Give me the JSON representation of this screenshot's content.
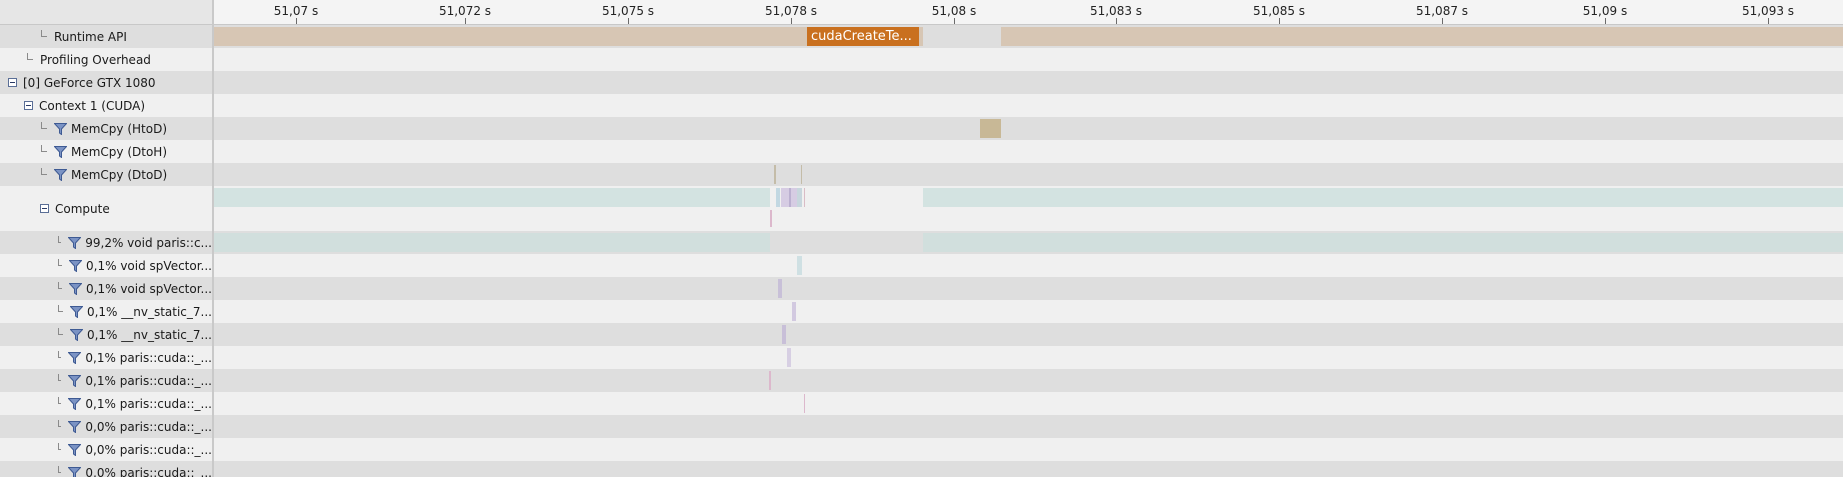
{
  "ruler": {
    "ticks": [
      "51,07 s",
      "51,072 s",
      "51,075 s",
      "51,078 s",
      "51,08 s",
      "51,083 s",
      "51,085 s",
      "51,087 s",
      "51,09 s",
      "51,093 s"
    ]
  },
  "tree": {
    "runtime_api": "Runtime API",
    "profiling_overhead": "Profiling Overhead",
    "gpu": "[0] GeForce GTX 1080",
    "context": "Context 1 (CUDA)",
    "memcpy_htod": "MemCpy (HtoD)",
    "memcpy_dtoh": "MemCpy (DtoH)",
    "memcpy_dtod": "MemCpy (DtoD)",
    "compute": "Compute",
    "kernels": [
      "99,2% void paris::c...",
      "0,1% void spVector...",
      "0,1% void spVector...",
      "0,1% __nv_static_7...",
      "0,1% __nv_static_7...",
      "0,1% paris::cuda::_...",
      "0,1% paris::cuda::_...",
      "0,1% paris::cuda::_...",
      "0,0% paris::cuda::_...",
      "0,0% paris::cuda::_...",
      "0,0% paris::cuda::_..."
    ]
  },
  "timeline": {
    "runtime_api_call": "cudaCreateTe..."
  },
  "colors": {
    "runtime_bar": "#d7c6b4",
    "runtime_call": "#c9701f",
    "compute_bar": "#d3e3e1",
    "htod": "#c8b896"
  }
}
